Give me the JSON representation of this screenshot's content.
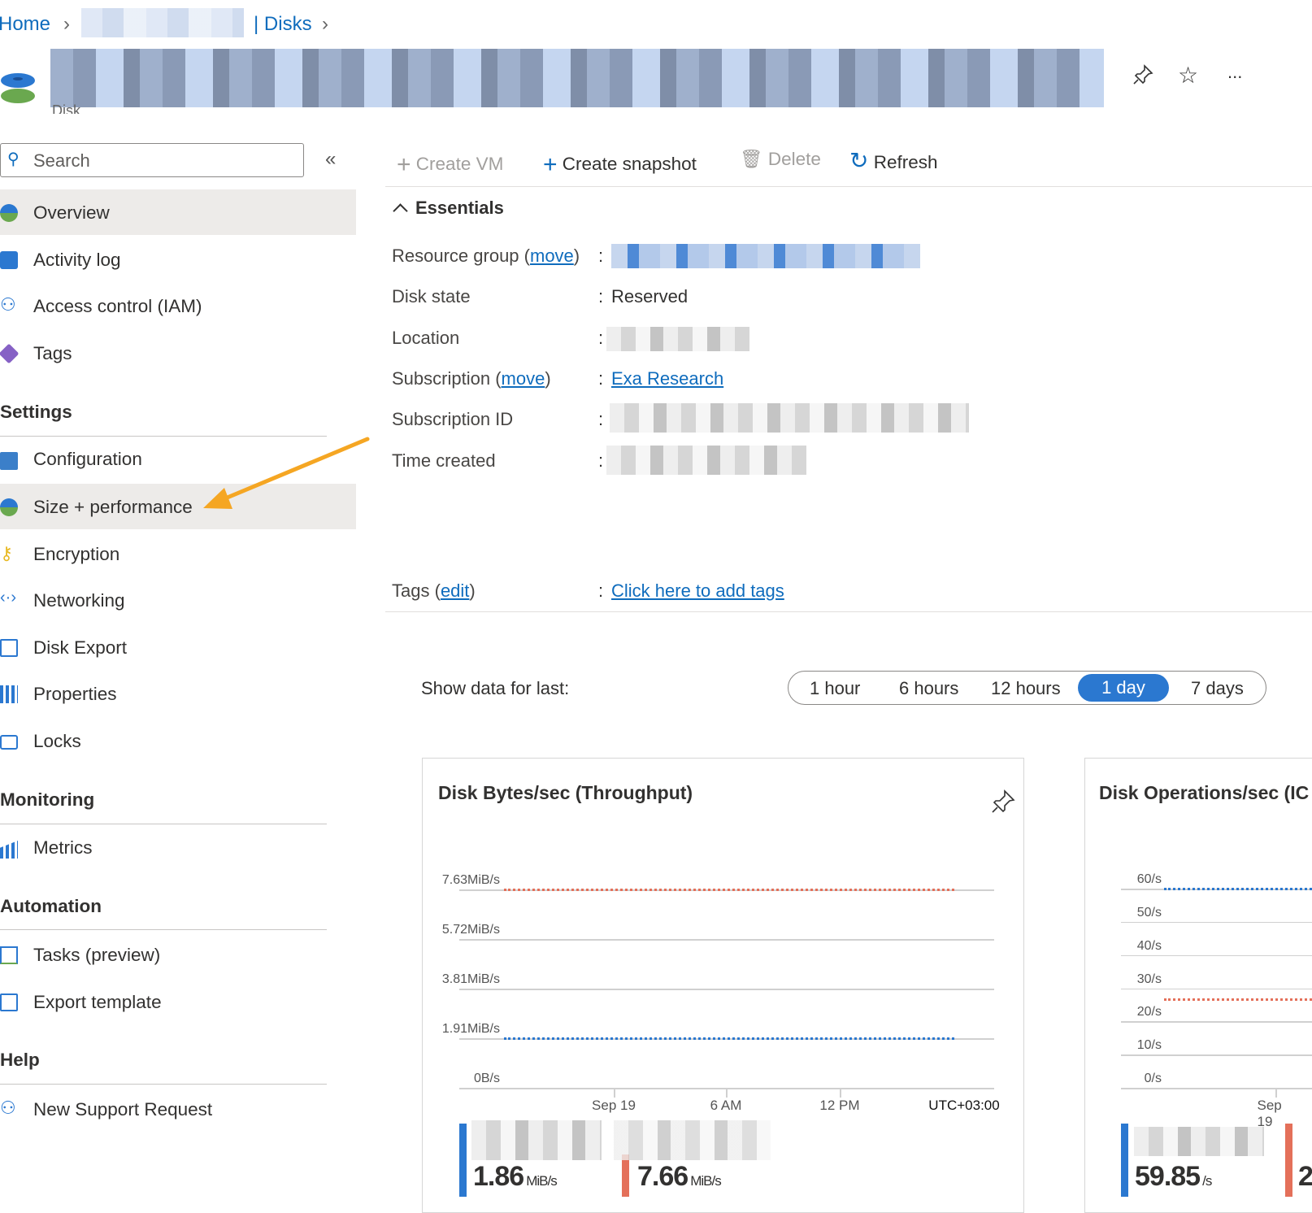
{
  "breadcrumb": {
    "home": "Home",
    "section": "| Disks"
  },
  "header": {
    "subtitle": "Disk",
    "actions": {
      "pin": "pin-icon",
      "favorite": "star-icon",
      "more": "..."
    }
  },
  "sidebar": {
    "search_placeholder": "Search",
    "collapse": "«",
    "items": [
      {
        "label": "Overview",
        "icon": "disk-icon"
      },
      {
        "label": "Activity log",
        "icon": "activity-log-icon"
      },
      {
        "label": "Access control (IAM)",
        "icon": "iam-icon"
      },
      {
        "label": "Tags",
        "icon": "tag-icon"
      }
    ],
    "sections": [
      {
        "title": "Settings",
        "items": [
          {
            "label": "Configuration"
          },
          {
            "label": "Size + performance"
          },
          {
            "label": "Encryption"
          },
          {
            "label": "Networking"
          },
          {
            "label": "Disk Export"
          },
          {
            "label": "Properties"
          },
          {
            "label": "Locks"
          }
        ]
      },
      {
        "title": "Monitoring",
        "items": [
          {
            "label": "Metrics"
          }
        ]
      },
      {
        "title": "Automation",
        "items": [
          {
            "label": "Tasks (preview)"
          },
          {
            "label": "Export template"
          }
        ]
      },
      {
        "title": "Help",
        "items": [
          {
            "label": "New Support Request"
          }
        ]
      }
    ]
  },
  "toolbar": {
    "create_vm": "Create VM",
    "create_snapshot": "Create snapshot",
    "delete": "Delete",
    "refresh": "Refresh"
  },
  "essentials": {
    "title": "Essentials",
    "resource_group_label": "Resource group",
    "move": "move",
    "disk_state_label": "Disk state",
    "disk_state": "Reserved",
    "location_label": "Location",
    "subscription_label": "Subscription",
    "subscription": "Exa Research",
    "subscription_id_label": "Subscription ID",
    "time_created_label": "Time created",
    "tags_label": "Tags",
    "edit": "edit",
    "tags_value": "Click here to add tags",
    "colon": ":"
  },
  "time_range": {
    "label": "Show data for last:",
    "options": [
      "1 hour",
      "6 hours",
      "12 hours",
      "1 day",
      "7 days"
    ],
    "selected": "1 day"
  },
  "colors": {
    "accent": "#0f6cbd",
    "selected_pill": "#2b78d0",
    "series_blue": "#2b78d0",
    "series_red": "#e4705a",
    "arrow": "#f5a623"
  },
  "chart_data": [
    {
      "type": "line",
      "title": "Disk Bytes/sec (Throughput)",
      "y_ticks": [
        "0B/s",
        "1.91MiB/s",
        "3.81MiB/s",
        "5.72MiB/s",
        "7.63MiB/s"
      ],
      "x_ticks": [
        "Sep 19",
        "6 AM",
        "12 PM"
      ],
      "timezone": "UTC+03:00",
      "series": [
        {
          "color": "#2b78d0",
          "level_mib": 1.91,
          "summary": "1.86",
          "unit": "MiB/s"
        },
        {
          "color": "#e4705a",
          "level_mib": 7.63,
          "summary": "7.66",
          "unit": "MiB/s"
        }
      ]
    },
    {
      "type": "line",
      "title": "Disk Operations/sec (IC",
      "y_ticks": [
        "0/s",
        "10/s",
        "20/s",
        "30/s",
        "40/s",
        "50/s",
        "60/s"
      ],
      "x_ticks": [
        "Sep 19"
      ],
      "series": [
        {
          "color": "#2b78d0",
          "level": 60,
          "summary": "59.85",
          "unit": "/s"
        },
        {
          "color": "#e4705a",
          "level": 26.8,
          "summary": "2",
          "unit": ""
        }
      ]
    }
  ]
}
